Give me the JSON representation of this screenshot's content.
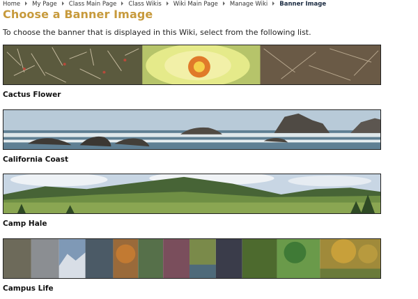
{
  "breadcrumb": {
    "items": [
      "Home",
      "My Page",
      "Class Main Page",
      "Class Wikis",
      "Wiki Main Page",
      "Manage Wiki"
    ],
    "current": "Banner Image"
  },
  "page": {
    "title": "Choose a Banner Image",
    "intro": "To choose the banner that is displayed in this Wiki, select from the following list."
  },
  "banners": [
    {
      "label": "Cactus Flower"
    },
    {
      "label": "California Coast"
    },
    {
      "label": "Camp Hale"
    },
    {
      "label": "Campus Life"
    }
  ],
  "colors": {
    "title": "#c79a3c",
    "breadcrumb_current": "#1a2a40"
  }
}
